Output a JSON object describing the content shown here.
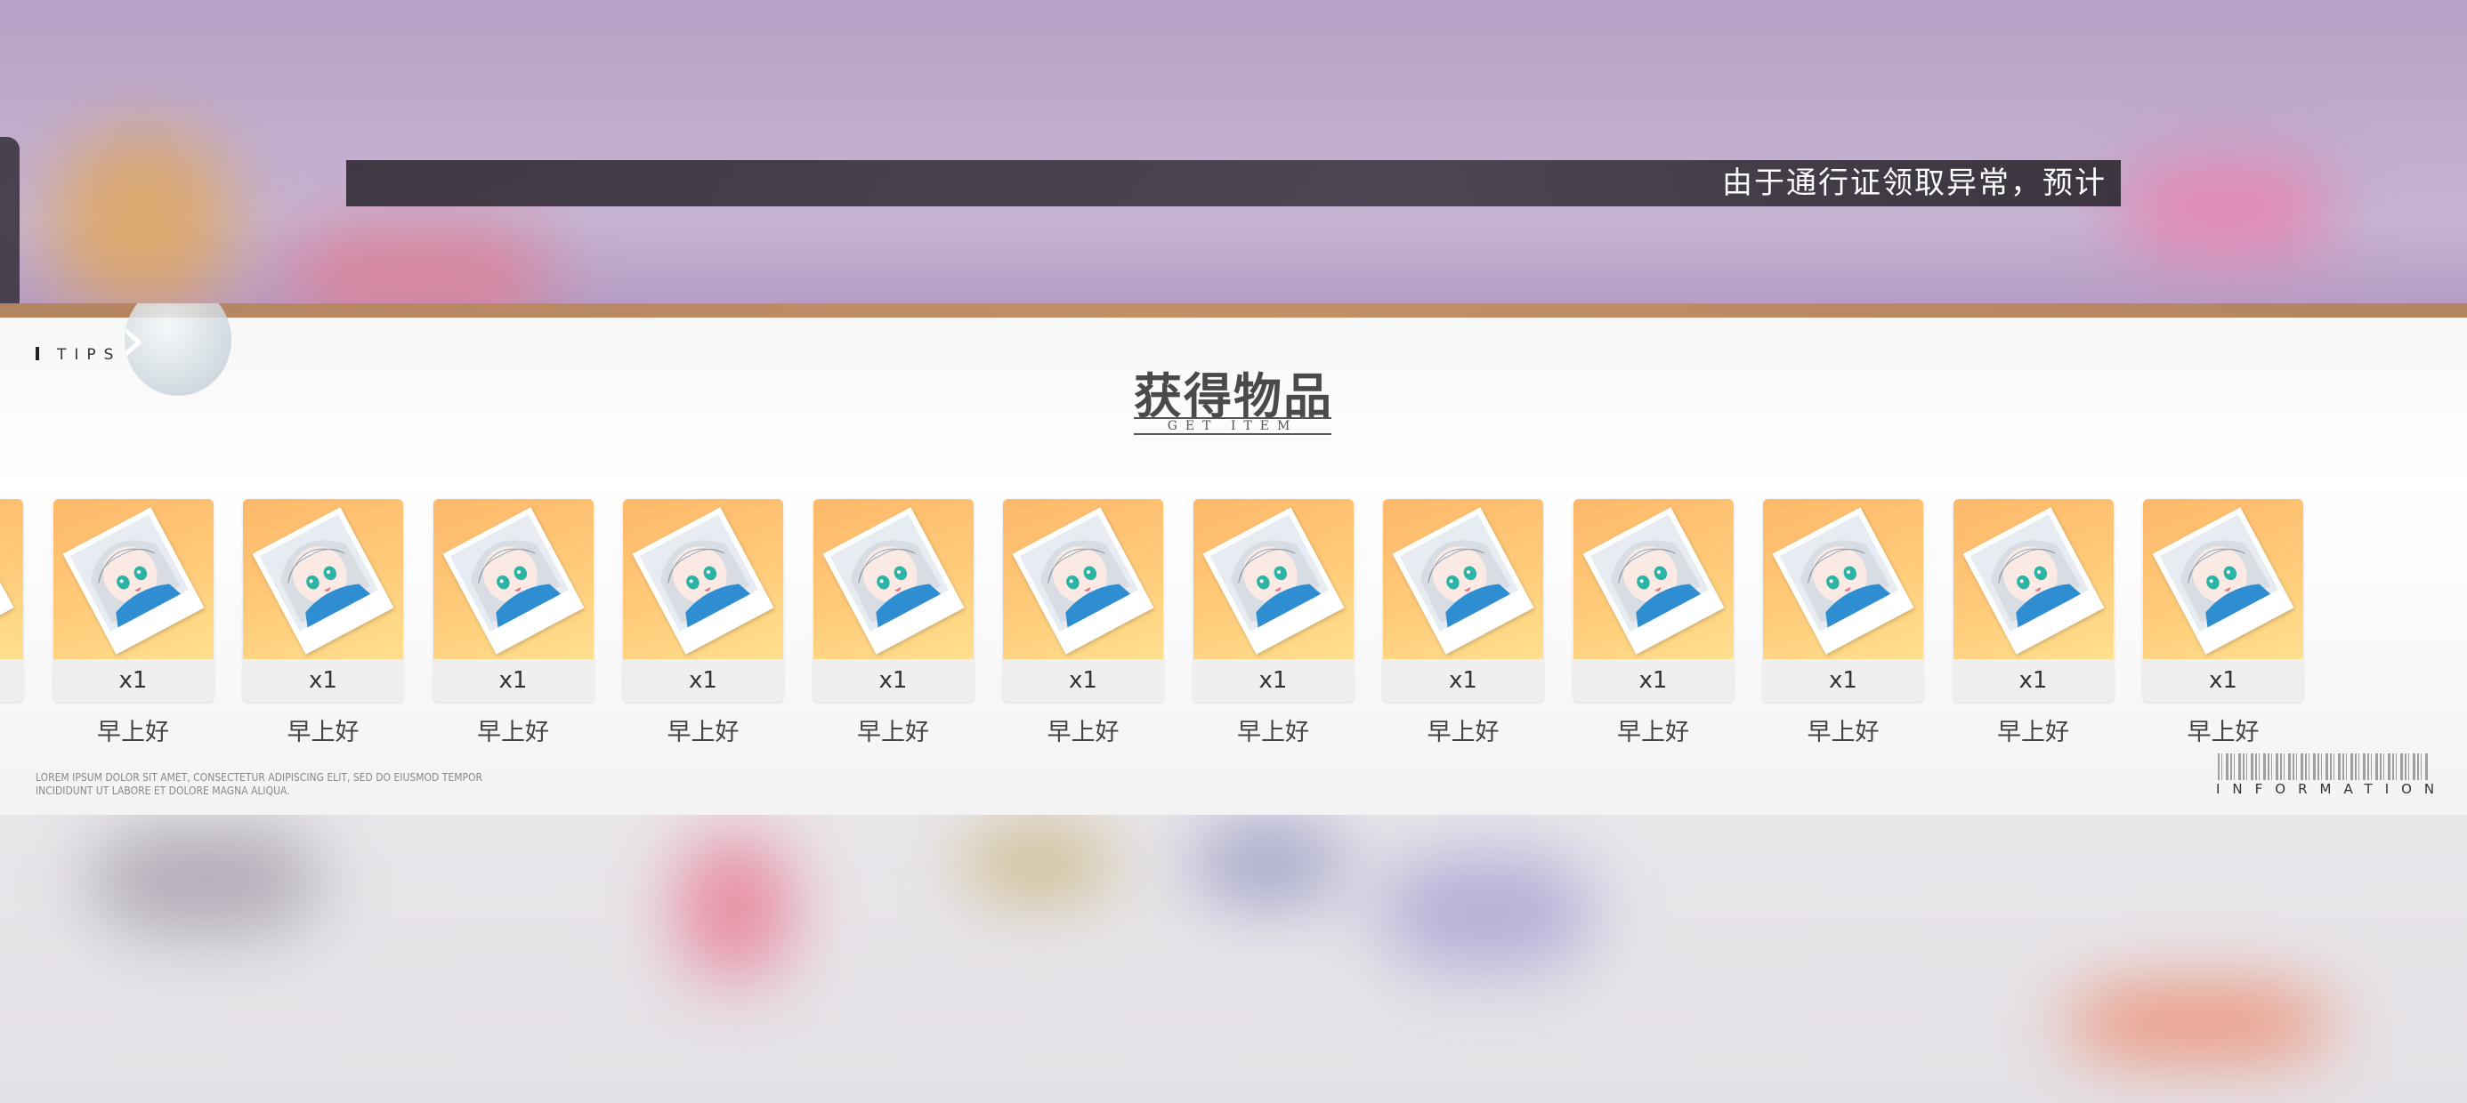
{
  "marquee": {
    "text": "由于通行证领取异常，预计"
  },
  "panel": {
    "tips_label": "TIPS",
    "title": "获得物品",
    "subtitle": "GET ITEM",
    "footer_lorem": "LOREM IPSUM DOLOR SIT AMET, CONSECTETUR ADIPISCING ELIT, SED DO EIUSMOD TEMPOR INCIDIDUNT UT LABORE ET DOLORE MAGNA ALIQUA.",
    "footer_info": "INFORMATION",
    "items": [
      {
        "qty": "x1",
        "name": "早上好"
      },
      {
        "qty": "x1",
        "name": "早上好"
      },
      {
        "qty": "x1",
        "name": "早上好"
      },
      {
        "qty": "x1",
        "name": "早上好"
      },
      {
        "qty": "x1",
        "name": "早上好"
      },
      {
        "qty": "x1",
        "name": "早上好"
      },
      {
        "qty": "x1",
        "name": "早上好"
      },
      {
        "qty": "x1",
        "name": "早上好"
      },
      {
        "qty": "x1",
        "name": "早上好"
      },
      {
        "qty": "x1",
        "name": "早上好"
      },
      {
        "qty": "x1",
        "name": "早上好"
      },
      {
        "qty": "x1",
        "name": "早上好"
      },
      {
        "qty": "x1",
        "name": "早上好"
      }
    ],
    "item_icon": "anime-character-photo-icon"
  },
  "colors": {
    "accent_stripe": "#b48360",
    "card_gradient_top": "#fdb86a",
    "card_gradient_bottom": "#ffe08e"
  }
}
